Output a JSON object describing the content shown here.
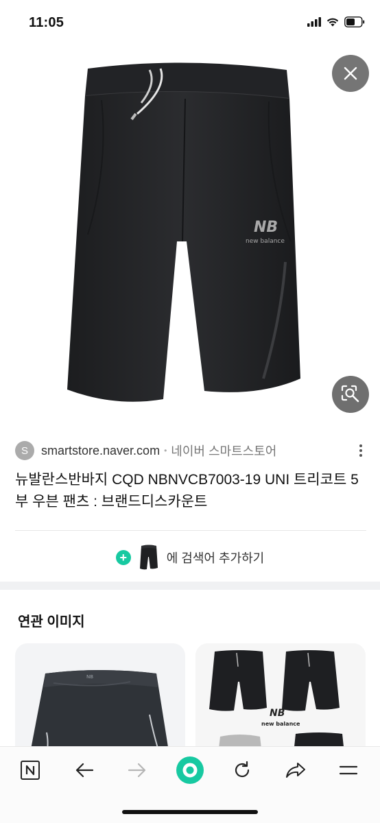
{
  "status_bar": {
    "time": "11:05",
    "icons": [
      "cellular-signal-icon",
      "wifi-icon",
      "battery-icon"
    ]
  },
  "viewer": {
    "close_icon": "close-icon",
    "lens_icon": "image-search-icon",
    "product_brand_mark": "new balance"
  },
  "result": {
    "favicon_letter": "S",
    "domain": "smartstore.naver.com",
    "separator": "•",
    "site_name": "네이버 스마트스토어",
    "title": "뉴발란스반바지 CQD NBNVCB7003-19 UNI 트리코트 5부 우븐 팬츠 : 브랜드디스카운트",
    "more_icon": "more-vertical-icon"
  },
  "add_search": {
    "text": "에 검색어 추가하기",
    "icon": "plus-icon"
  },
  "related": {
    "title": "연관 이미지",
    "cards": [
      {
        "name": "related-image-1",
        "brand_mark": "NB"
      },
      {
        "name": "related-image-2",
        "brand_mark": "new balance"
      }
    ]
  },
  "bottom_nav": {
    "items": [
      "naver-n-icon",
      "back-arrow-icon",
      "forward-arrow-icon",
      "home-green-icon",
      "refresh-icon",
      "share-icon",
      "menu-icon"
    ]
  },
  "colors": {
    "accent_green": "#17c9a1",
    "overlay_button": "#757575"
  }
}
